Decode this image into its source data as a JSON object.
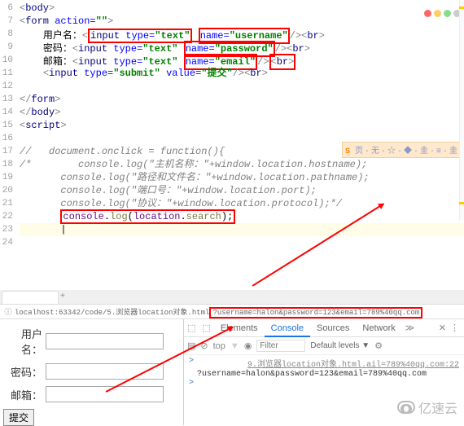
{
  "editor": {
    "line_start": 6,
    "lines": {
      "l6": {
        "body_open": "<body>"
      },
      "l7": {
        "form": "<form",
        "attr": "action=",
        "val": "\"\"",
        "close": ">"
      },
      "l8": {
        "label": "用户名：",
        "input": "<input",
        "type_attr": "type=",
        "type_val": "\"text\"",
        "name_attr": "name=",
        "name_val": "\"username\"",
        "end": "/><br>"
      },
      "l9": {
        "label": "密码：",
        "input": "<input",
        "type_attr": "type=",
        "type_val": "\"text\"",
        "name_attr": "name=",
        "name_val": "\"password\"",
        "end": "/><br>"
      },
      "l10": {
        "label": "邮箱：",
        "input": "<input",
        "type_attr": "type=",
        "type_val": "\"text\"",
        "name_attr": "name=",
        "name_val": "\"email\"",
        "end": "/><br>"
      },
      "l11": {
        "input": "<input",
        "type_attr": "type=",
        "type_val": "\"submit\"",
        "value_attr": "value=",
        "value_val": "\"提交\"",
        "end": "/><br>"
      },
      "l12": "",
      "l13": "</form>",
      "l14": "</body>",
      "l15": "<script>",
      "l16": "",
      "l17": "//   document.onclick = function(){",
      "l18": "/*        console.log(\"主机名称：\"+window.location.hostname);",
      "l19": "       console.log(\"路径和文件名：\"+window.location.pathname);",
      "l20": "       console.log(\"端口号：\"+window.location.port);",
      "l21": "       console.log(\"协议：\"+window.location.protocol);*/",
      "l22": {
        "console": "console",
        "dot1": ".",
        "log": "log",
        "open": "(",
        "location": "location",
        "dot2": ".",
        "search": "search",
        "close": ");"
      },
      "l23": "",
      "l24": ""
    }
  },
  "toolbar_mid": {
    "text_prefix": "S",
    "text_rest": "页·无·☆·◆·圭·≡·圭"
  },
  "browser": {
    "url_prefix": "localhost:63342/code/5.浏览器location对象.html",
    "url_query": "?username=halon&password=123&email=789%40qq.com"
  },
  "form": {
    "username_label": "用户名：",
    "password_label": "密码：",
    "email_label": "邮箱：",
    "submit_label": "提交"
  },
  "devtools": {
    "tabs": {
      "elements": "Elements",
      "console": "Console",
      "sources": "Sources",
      "network": "Network"
    },
    "chev_count": "≫",
    "select_icon": "⬚",
    "device_icon": "⬚",
    "clear_icon": "⊘",
    "top": "top",
    "eye": "◉",
    "filter_placeholder": "Filter",
    "levels": "Default levels ▼",
    "gear": "⚙",
    "dots": "⋮",
    "x": "✕",
    "link_text": "9.浏览器location对象.html.ail=789%40qq.com:22",
    "output": "?username=halon&password=123&email=789%40qq.com",
    "prompt": ">",
    "prompt2": ">"
  },
  "watermark": "亿速云"
}
